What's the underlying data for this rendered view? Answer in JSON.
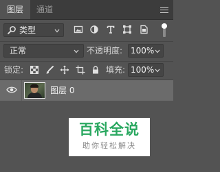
{
  "tabs": [
    {
      "label": "图层",
      "active": true
    },
    {
      "label": "通道",
      "active": false
    }
  ],
  "filter": {
    "kind_label": "类型",
    "icons": [
      "image-filter-icon",
      "adjustment-filter-icon",
      "type-filter-icon",
      "shape-filter-icon",
      "smart-object-filter-icon"
    ]
  },
  "blend": {
    "mode": "正常",
    "opacity_label": "不透明度:",
    "opacity_value": "100%"
  },
  "lock": {
    "label": "锁定:",
    "icons": [
      "lock-transparent-pixels-icon",
      "lock-image-pixels-icon",
      "lock-position-icon",
      "lock-artboard-icon",
      "lock-all-icon"
    ],
    "fill_label": "填充:",
    "fill_value": "100%"
  },
  "layers": [
    {
      "name": "图层 0",
      "visible": true
    }
  ],
  "watermark": {
    "title": "百科全说",
    "subtitle": "助你轻松解决"
  },
  "colors": {
    "panel_bg": "#535353",
    "tab_bar_bg": "#3c3c3c",
    "layer_selected_bg": "#6b6b6b",
    "watermark_green": "#2aa860"
  }
}
